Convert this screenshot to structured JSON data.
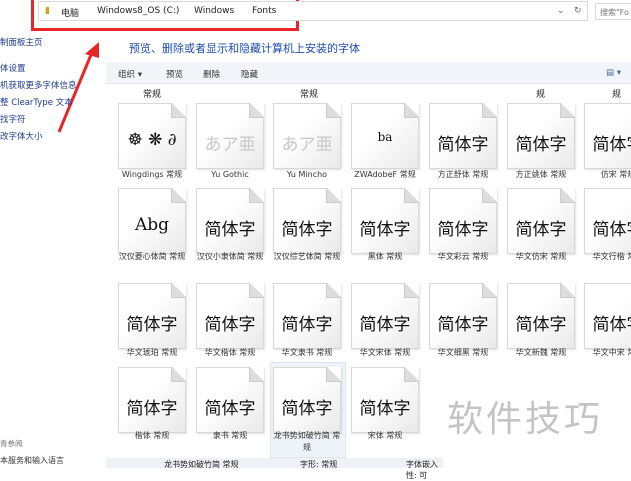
{
  "address": {
    "crumbs": [
      "电脑",
      "Windows8_OS (C:)",
      "Windows",
      "Fonts"
    ],
    "search_placeholder": "搜索\"Fo"
  },
  "sidebar": {
    "items": [
      "制面板主页",
      "体设置",
      "机获取更多字体信息",
      "整 ClearType 文本",
      "找字符",
      "改字体大小"
    ],
    "see_also": "青参阅",
    "see_also_items": [
      "本服务和输入语言"
    ]
  },
  "header": {
    "title": "预览、删除或者显示和隐藏计算机上安装的字体"
  },
  "toolbar": {
    "organize": "组织 ▾",
    "preview": "预览",
    "delete": "删除",
    "hide": "隐藏",
    "view": "▤ ▾"
  },
  "top_labels": [
    "常规",
    "常规",
    "规",
    "规"
  ],
  "fonts": [
    {
      "name": "Wingdings 常规",
      "sample": "☸ ❋ ∂",
      "faint": false
    },
    {
      "name": "Yu Gothic",
      "sample": "あア亜",
      "faint": true
    },
    {
      "name": "Yu Mincho",
      "sample": "あア亜",
      "faint": true
    },
    {
      "name": "ZWAdobeF 常规",
      "sample": "ba",
      "faint": false
    },
    {
      "name": "方正舒体 常规",
      "sample": "简体字",
      "faint": false
    },
    {
      "name": "方正姚体 常规",
      "sample": "简体字",
      "faint": false
    },
    {
      "name": "仿宋 常规",
      "sample": "简体字",
      "faint": false
    },
    {
      "name": "汉仪菱心体简 常规",
      "sample": "Abg",
      "faint": false
    },
    {
      "name": "汉仪小隶体简 常规",
      "sample": "简体字",
      "faint": false
    },
    {
      "name": "汉仪综艺体简 常规",
      "sample": "简体字",
      "faint": false
    },
    {
      "name": "黑体 常规",
      "sample": "简体字",
      "faint": false
    },
    {
      "name": "华文彩云 常规",
      "sample": "简体字",
      "faint": false
    },
    {
      "name": "华文仿宋 常规",
      "sample": "简体字",
      "faint": false
    },
    {
      "name": "华文行楷 常规",
      "sample": "简体字",
      "faint": false
    },
    {
      "name": "华文琥珀 常规",
      "sample": "简体字",
      "faint": false
    },
    {
      "name": "华文楷体 常规",
      "sample": "简体字",
      "faint": false
    },
    {
      "name": "华文隶书 常规",
      "sample": "简体字",
      "faint": false
    },
    {
      "name": "华文宋体 常规",
      "sample": "简体字",
      "faint": false
    },
    {
      "name": "华文细黑 常规",
      "sample": "简体字",
      "faint": false
    },
    {
      "name": "华文新魏 常规",
      "sample": "简体字",
      "faint": false
    },
    {
      "name": "华文中宋 常规",
      "sample": "简体字",
      "faint": false
    },
    {
      "name": "楷体 常规",
      "sample": "简体字",
      "faint": false
    },
    {
      "name": "隶书 常规",
      "sample": "简体字",
      "faint": false
    },
    {
      "name": "龙书势如破竹简 常规",
      "sample": "简体字",
      "faint": false
    },
    {
      "name": "宋体 常规",
      "sample": "简体字",
      "faint": false
    }
  ],
  "details": {
    "name": "龙书势如破竹简 常规",
    "style": "字形: 常规",
    "embed": "字体嵌入性: 可"
  },
  "watermark": "软件技巧"
}
